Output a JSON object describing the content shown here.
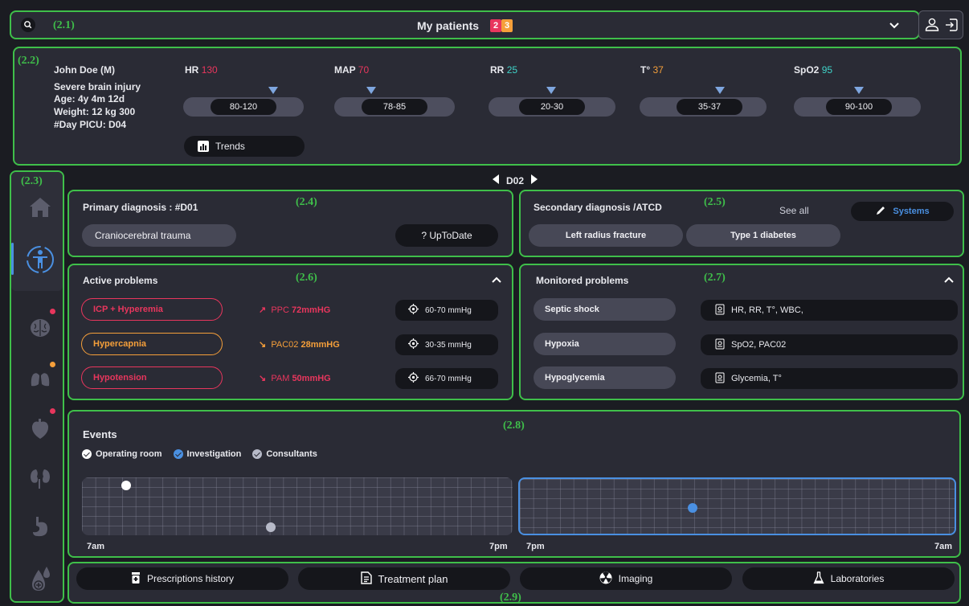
{
  "header": {
    "title": "My patients",
    "badges": [
      {
        "value": "2",
        "color": "#e8365d"
      },
      {
        "value": "3",
        "color": "#f59f3a"
      }
    ],
    "tag": "(2.1)"
  },
  "patient": {
    "tag": "(2.2)",
    "name": "John Doe (M)",
    "diagnosis": "Severe brain injury",
    "age": "Age: 4y 4m 12d",
    "weight": "Weight: 12 kg 300",
    "day": "#Day PICU: D04",
    "trends_label": "Trends"
  },
  "vitals": [
    {
      "name": "HR",
      "value": "130",
      "color": "#e8365d",
      "range": "80-120"
    },
    {
      "name": "MAP",
      "value": "70",
      "color": "#e8365d",
      "range": "78-85"
    },
    {
      "name": "RR",
      "value": "25",
      "color": "#3fd3c8",
      "range": "20-30"
    },
    {
      "name": "T°",
      "value": "37",
      "color": "#f59f3a",
      "range": "35-37"
    },
    {
      "name": "SpO2",
      "value": "95",
      "color": "#3fd3c8",
      "range": "90-100"
    }
  ],
  "sidebar": {
    "tag": "(2.3)"
  },
  "day_nav": {
    "label": "D02"
  },
  "primary": {
    "tag": "(2.4)",
    "title": "Primary diagnosis : #D01",
    "diagnosis": "Craniocerebral trauma",
    "uptodate": "? UpToDate"
  },
  "secondary": {
    "tag": "(2.5)",
    "title": "Secondary diagnosis /ATCD",
    "see_all": "See all",
    "systems": "Systems",
    "items": [
      "Left radius fracture",
      "Type 1 diabetes"
    ]
  },
  "active": {
    "tag": "(2.6)",
    "title": "Active problems",
    "items": [
      {
        "name": "ICP + Hyperemia",
        "color": "#e8365d",
        "arrow": "↗",
        "param": "PPC",
        "value": "72mmHG",
        "target": "60-70 mmHg"
      },
      {
        "name": "Hypercapnia",
        "color": "#f59f3a",
        "arrow": "↘",
        "param": "PAC02",
        "value": "28mmHG",
        "target": "30-35 mmHg"
      },
      {
        "name": "Hypotension",
        "color": "#e8365d",
        "arrow": "↘",
        "param": "PAM",
        "value": "50mmHG",
        "target": "66-70 mmHg"
      }
    ]
  },
  "monitored": {
    "tag": "(2.7)",
    "title": "Monitored problems",
    "items": [
      {
        "name": "Septic shock",
        "params": "HR, RR, T°, WBC,"
      },
      {
        "name": "Hypoxia",
        "params": "SpO2, PAC02"
      },
      {
        "name": "Hypoglycemia",
        "params": "Glycemia, T°"
      }
    ]
  },
  "events": {
    "tag": "(2.8)",
    "title": "Events",
    "filters": [
      {
        "label": "Operating room",
        "color": "#ffffff"
      },
      {
        "label": "Investigation",
        "color": "#4a90e2"
      },
      {
        "label": "Consultants",
        "color": "#b7bac8"
      }
    ],
    "left_start": "7am",
    "left_end": "7pm",
    "right_start": "7pm",
    "right_end": "7am"
  },
  "footer": {
    "tag": "(2.9)",
    "buttons": [
      "Prescriptions history",
      "Treatment plan",
      "Imaging",
      "Laboratories"
    ]
  }
}
